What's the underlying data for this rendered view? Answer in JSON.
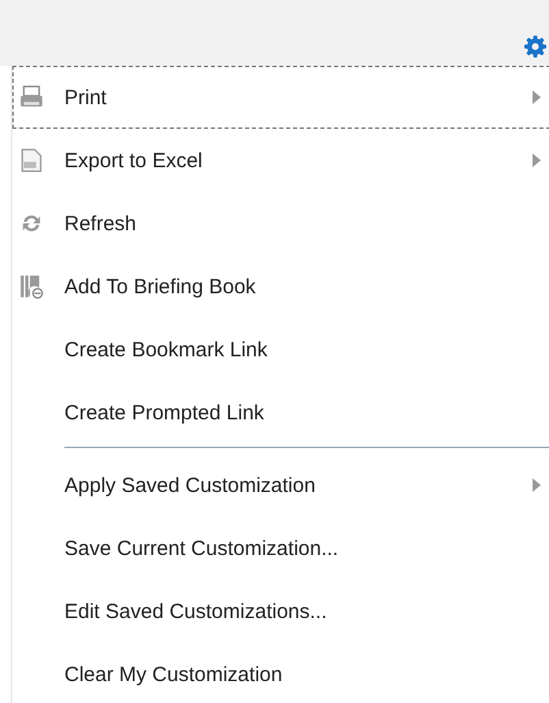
{
  "menu": {
    "items": [
      {
        "kind": "item",
        "label": "Print",
        "submenu": true,
        "focused": true
      },
      {
        "kind": "item",
        "label": "Export to Excel",
        "submenu": true,
        "focused": false
      },
      {
        "kind": "item",
        "label": "Refresh",
        "submenu": false,
        "focused": false
      },
      {
        "kind": "item",
        "label": "Add To Briefing Book",
        "submenu": false,
        "focused": false
      },
      {
        "kind": "item",
        "label": "Create Bookmark Link",
        "submenu": false,
        "focused": false
      },
      {
        "kind": "item",
        "label": "Create Prompted Link",
        "submenu": false,
        "focused": false
      },
      {
        "kind": "separator"
      },
      {
        "kind": "item",
        "label": "Apply Saved Customization",
        "submenu": true,
        "focused": false
      },
      {
        "kind": "item",
        "label": "Save Current Customization...",
        "submenu": false,
        "focused": false
      },
      {
        "kind": "item",
        "label": "Edit Saved Customizations...",
        "submenu": false,
        "focused": false
      },
      {
        "kind": "item",
        "label": "Clear My Customization",
        "submenu": false,
        "focused": false
      }
    ]
  }
}
